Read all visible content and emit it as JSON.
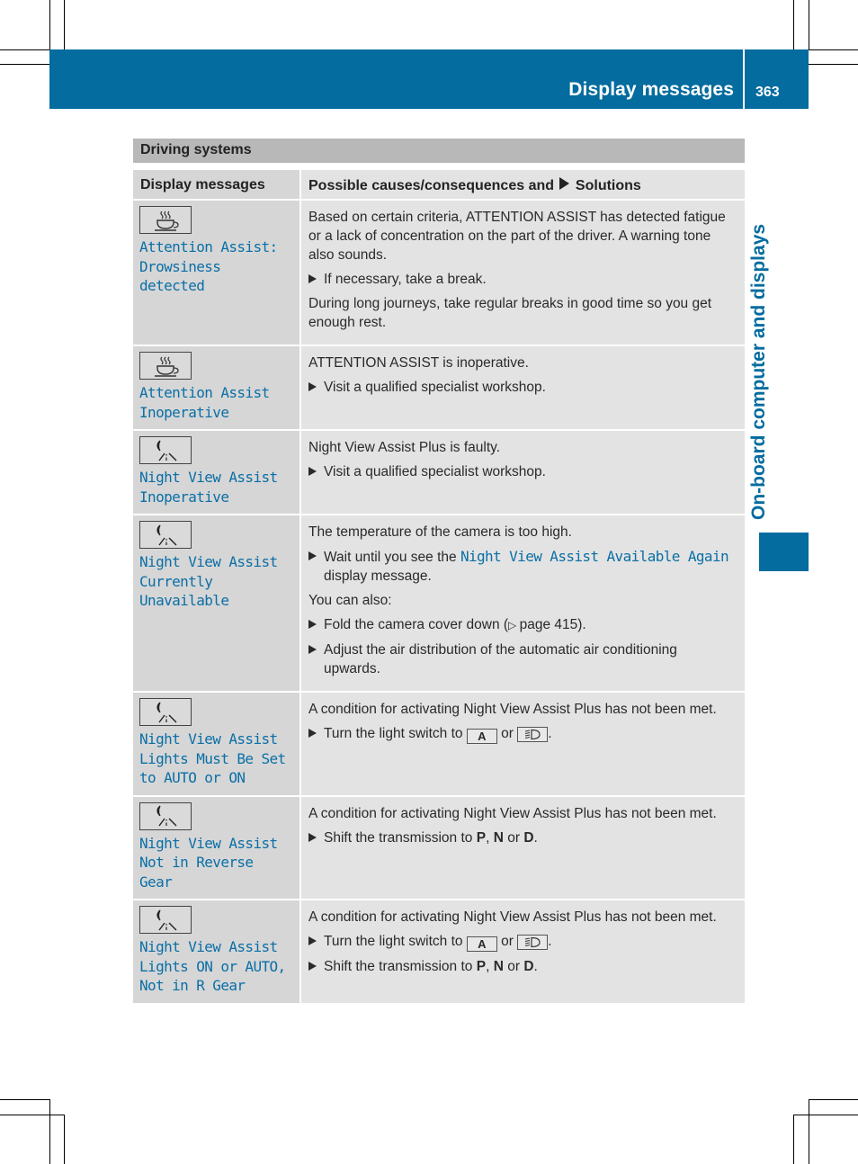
{
  "header": {
    "title": "Display messages",
    "page_number": "363",
    "accent_color": "#046c9e"
  },
  "side_tab": {
    "label": "On-board computer and displays"
  },
  "section": {
    "title": "Driving systems"
  },
  "table": {
    "col1_header": "Display messages",
    "col2_header_pre": "Possible causes/consequences and",
    "col2_header_post": "Solutions",
    "rows": [
      {
        "icon": "coffee-cup-icon",
        "message": "Attention Assist:\nDrowsiness\ndetected",
        "blocks": [
          {
            "type": "para",
            "text": "Based on certain criteria, ATTENTION ASSIST has detected fatigue or a lack of concentration on the part of the driver. A warning tone also sounds."
          },
          {
            "type": "bullet",
            "text": "If necessary, take a break."
          },
          {
            "type": "para",
            "text": "During long journeys, take regular breaks in good time so you get enough rest."
          }
        ]
      },
      {
        "icon": "coffee-cup-icon",
        "message": "Attention Assist\nInoperative",
        "blocks": [
          {
            "type": "para",
            "text": "ATTENTION ASSIST is inoperative."
          },
          {
            "type": "bullet",
            "text": "Visit a qualified specialist workshop."
          }
        ]
      },
      {
        "icon": "night-view-icon",
        "message": "Night View Assist\nInoperative",
        "blocks": [
          {
            "type": "para",
            "text": "Night View Assist Plus is faulty."
          },
          {
            "type": "bullet",
            "text": "Visit a qualified specialist workshop."
          }
        ]
      },
      {
        "icon": "night-view-icon",
        "message": "Night View Assist\nCurrently\nUnavailable",
        "blocks": [
          {
            "type": "para",
            "text": "The temperature of the camera is too high."
          },
          {
            "type": "bullet",
            "pre": "Wait until you see the",
            "mono": "Night View Assist Available Again",
            "post": "display message."
          },
          {
            "type": "para",
            "text": "You can also:"
          },
          {
            "type": "bullet",
            "pre": "Fold the camera cover down (",
            "ref": "page 415",
            "post": ")."
          },
          {
            "type": "bullet",
            "text": "Adjust the air distribution of the automatic air conditioning upwards."
          }
        ]
      },
      {
        "icon": "night-view-icon",
        "message": "Night View Assist\nLights Must Be Set\nto AUTO or ON",
        "blocks": [
          {
            "type": "para",
            "text": "A condition for activating Night View Assist Plus has not been met."
          },
          {
            "type": "bullet",
            "pre": "Turn the light switch to",
            "key1": "A",
            "mid": "or",
            "key2": "low-beam-headlamp-icon",
            "post": "."
          }
        ]
      },
      {
        "icon": "night-view-icon",
        "message": "Night View Assist\nNot in Reverse Gear",
        "blocks": [
          {
            "type": "para",
            "text": "A condition for activating Night View Assist Plus has not been met."
          },
          {
            "type": "bullet",
            "pre": "Shift the transmission to",
            "g1": "P",
            "g2": "N",
            "g3": "D"
          }
        ]
      },
      {
        "icon": "night-view-icon",
        "message": "Night View Assist\nLights ON or AUTO,\nNot in R Gear",
        "blocks": [
          {
            "type": "para",
            "text": "A condition for activating Night View Assist Plus has not been met."
          },
          {
            "type": "bullet",
            "pre": "Turn the light switch to",
            "key1": "A",
            "mid": "or",
            "key2": "low-beam-headlamp-icon",
            "post": "."
          },
          {
            "type": "bullet",
            "pre": "Shift the transmission to",
            "g1": "P",
            "g2": "N",
            "g3": "D"
          }
        ]
      }
    ]
  }
}
